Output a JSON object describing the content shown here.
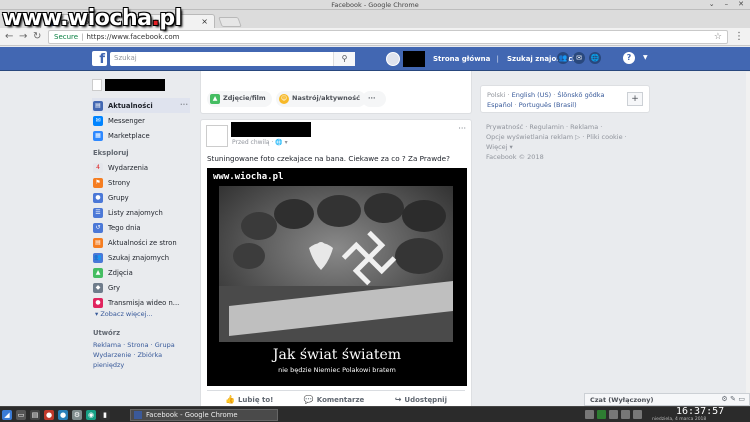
{
  "window": {
    "title": "Facebook - Google Chrome",
    "controls": [
      "⌄",
      "–",
      "✕"
    ]
  },
  "watermark": {
    "text": "www.wiocha",
    "dot": ".",
    "tld": "pl"
  },
  "browser": {
    "tab_title": "Facebook",
    "tab_icon": "f",
    "tab_close": "×",
    "secure_label": "Secure",
    "url": "https://www.facebook.com",
    "back": "←",
    "forward": "→",
    "reload": "↻",
    "star": "☆",
    "menu": "⋮"
  },
  "fb_header": {
    "logo": "f",
    "search_placeholder": "Szukaj",
    "search_icon": "⚲",
    "nav_home": "Strona główna",
    "nav_find_friends": "Szukaj znajomych",
    "icon_friends": "👥",
    "icon_messages": "✉",
    "icon_notifications": "🌐",
    "icon_help": "?",
    "caret": "▼",
    "brand_color": "#4267b2"
  },
  "sidebar": {
    "items": [
      {
        "label": "Aktualności",
        "icon": "news-feed-icon",
        "color": "#4267b2",
        "active": true,
        "glyph": "▤"
      },
      {
        "label": "Messenger",
        "icon": "messenger-icon",
        "color": "#0084ff",
        "glyph": "✉"
      },
      {
        "label": "Marketplace",
        "icon": "marketplace-icon",
        "color": "#2d88ff",
        "glyph": "▦"
      }
    ],
    "explore_heading": "Eksploruj",
    "explore": [
      {
        "label": "Wydarzenia",
        "icon": "calendar-icon",
        "color": "#e4e6eb",
        "glyph": "4",
        "fg": "#e02020"
      },
      {
        "label": "Strony",
        "icon": "flag-icon",
        "color": "#f57d21",
        "glyph": "⚑"
      },
      {
        "label": "Grupy",
        "icon": "groups-icon",
        "color": "#4b78d7",
        "glyph": "●"
      },
      {
        "label": "Listy znajomych",
        "icon": "friend-lists-icon",
        "color": "#4b78d7",
        "glyph": "☰"
      },
      {
        "label": "Tego dnia",
        "icon": "on-this-day-icon",
        "color": "#4b78d7",
        "glyph": "↺"
      },
      {
        "label": "Aktualności ze stron",
        "icon": "pages-feed-icon",
        "color": "#f57d21",
        "glyph": "▤"
      },
      {
        "label": "Szukaj znajomych",
        "icon": "find-friends-icon",
        "color": "#4b78d7",
        "glyph": "👥"
      },
      {
        "label": "Zdjęcia",
        "icon": "photos-icon",
        "color": "#45bd62",
        "glyph": "▲"
      },
      {
        "label": "Gry",
        "icon": "games-icon",
        "color": "#6f7c8b",
        "glyph": "◆"
      },
      {
        "label": "Transmisja wideo n...",
        "icon": "live-video-icon",
        "color": "#e0245e",
        "glyph": "●"
      }
    ],
    "more_label": "Zobacz więcej...",
    "create_heading": "Utwórz",
    "create_links": "Reklama · Strona · Grupa",
    "create_links2": "Wydarzenie · Zbiórka",
    "create_links3": "pieniędzy",
    "item_dots": "···"
  },
  "composer": {
    "photo_label": "Zdjęcie/film",
    "feeling_label": "Nastrój/aktywność",
    "more": "···"
  },
  "post": {
    "time": "Przed chwilą · 🌐 ▾",
    "menu": "···",
    "text": "Stuningowane foto czekajace na bana. Ciekawe za co ? Za Prawde?",
    "image_site": "www.wiocha.pl",
    "image_title": "Jak świat światem",
    "image_subtitle": "nie będzie Niemiec Polakowi bratem",
    "like": "Lubię to!",
    "comment": "Komentarze",
    "share": "Udostępnij"
  },
  "right": {
    "languages": {
      "line1_a": "Polski",
      "line1_b": "English (US)",
      "line1_c": "Ślōnskŏ gŏdka",
      "line2_a": "Español",
      "line2_b": "Português (Brasil)",
      "add": "+"
    },
    "footer_line1": "Prywatność · Regulamin · Reklama ·",
    "footer_line2": "Opcje wyświetlania reklam ▷ · Pliki cookie ·",
    "footer_line3": "Więcej ▾",
    "footer_line4": "Facebook © 2018"
  },
  "chat": {
    "label": "Czat (Wyłączony)",
    "icons": "⚙ ✎ ▭"
  },
  "taskbar": {
    "task_label": "Facebook - Google Chrome",
    "clock": "16:37:57",
    "date": "niedziela, 4 marca 2018"
  }
}
